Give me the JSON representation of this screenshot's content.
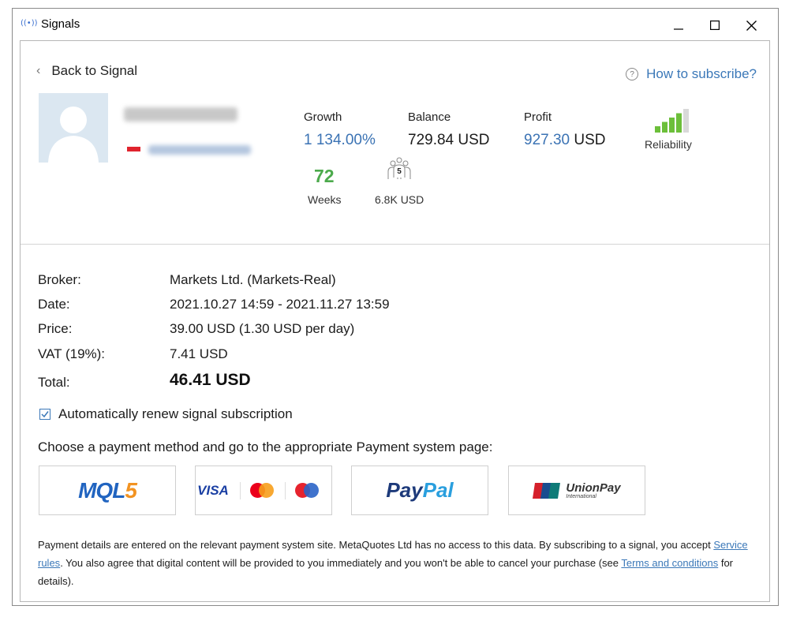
{
  "window": {
    "title": "Signals",
    "title_icon_glyph": "((•))",
    "controls": {
      "minimize": "minimize-icon",
      "maximize": "maximize-icon",
      "close": "close-icon"
    }
  },
  "header": {
    "back_label": "Back to Signal",
    "how_to_label": "How to subscribe?",
    "help_glyph": "?"
  },
  "signal": {
    "flag_color": "#e0242e"
  },
  "stats": {
    "growth_label": "Growth",
    "growth_value": "1 134.00%",
    "balance_label": "Balance",
    "balance_value": "729.84 USD",
    "profit_label": "Profit",
    "profit_amount": "927.30",
    "profit_currency": "USD",
    "reliability_label": "Reliability",
    "reliability_level": 4,
    "reliability_max": 5,
    "weeks_value": "72",
    "weeks_label": "Weeks",
    "subscribers_count": "5",
    "subscribers_label": "6.8K USD"
  },
  "order": {
    "broker_label": "Broker:",
    "broker_value": "Markets Ltd. (Markets-Real)",
    "date_label": "Date:",
    "date_value": "2021.10.27 14:59 - 2021.11.27 13:59",
    "price_label": "Price:",
    "price_value": "39.00 USD (1.30 USD per day)",
    "vat_label": "VAT (19%):",
    "vat_value": "7.41 USD",
    "total_label": "Total:",
    "total_value": "46.41 USD"
  },
  "renew": {
    "checked": true,
    "label": "Automatically renew signal subscription"
  },
  "payment": {
    "prompt": "Choose a payment method and go to the appropriate Payment system page:",
    "mql5_a": "MQL",
    "mql5_b": "5",
    "visa": "VISA",
    "paypal_a": "Pay",
    "paypal_b": "Pal",
    "unionpay": "UnionPay",
    "unionpay_sub": "International"
  },
  "footer": {
    "text1": "Payment details are entered on the relevant payment system site. MetaQuotes Ltd has no access to this data. By subscribing to a signal, you accept ",
    "link1": "Service rules",
    "text2": ". You also agree that digital content will be provided to you immediately and you won't be able to cancel your purchase (see ",
    "link2": "Terms and conditions",
    "text3": " for details)."
  },
  "colors": {
    "accent_blue": "#3b78b8",
    "growth_green": "#4caa4c",
    "reliability_green": "#6cbf3a",
    "reliability_empty": "#d9d9d9"
  }
}
